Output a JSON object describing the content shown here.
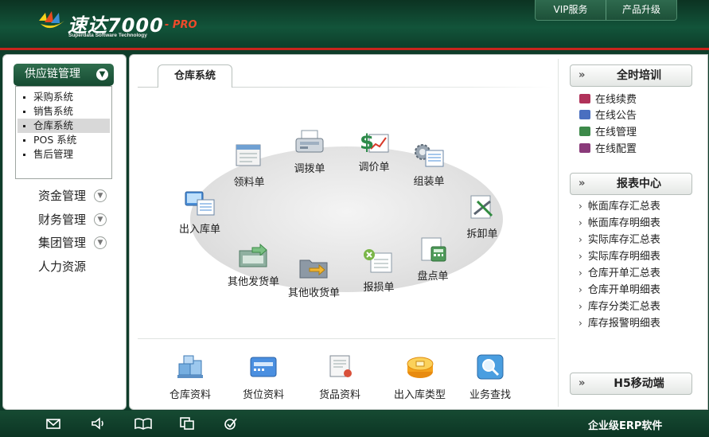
{
  "header": {
    "logo_title": "速达7000",
    "logo_suffix": "- PRO",
    "logo_subtitle": "Superdata Software Technology",
    "links": [
      "VIP服务",
      "产品升级"
    ]
  },
  "sidebar": {
    "active_category": "供应链管理",
    "sub_items": [
      {
        "label": "采购系统",
        "selected": false
      },
      {
        "label": "销售系统",
        "selected": false
      },
      {
        "label": "仓库系统",
        "selected": true
      },
      {
        "label": "POS 系统",
        "selected": false
      },
      {
        "label": "售后管理",
        "selected": false
      }
    ],
    "categories": [
      "资金管理",
      "财务管理",
      "集团管理",
      "人力资源"
    ]
  },
  "main": {
    "tab": "仓库系统",
    "workflow": [
      "出入库单",
      "领料单",
      "调拨单",
      "调价单",
      "组装单",
      "拆卸单",
      "盘点单",
      "报损单",
      "其他收货单",
      "其他发货单"
    ],
    "bottom_tools": [
      "仓库资料",
      "货位资料",
      "货品资料",
      "出入库类型",
      "业务查找"
    ]
  },
  "right": {
    "training": {
      "title": "全时培训",
      "items": [
        "在线续费",
        "在线公告",
        "在线管理",
        "在线配置"
      ]
    },
    "reports": {
      "title": "报表中心",
      "items": [
        "帐面库存汇总表",
        "帐面库存明细表",
        "实际库存汇总表",
        "实际库存明细表",
        "仓库开单汇总表",
        "仓库开单明细表",
        "库存分类汇总表",
        "库存报警明细表"
      ]
    },
    "mobile": {
      "title": "H5移动端"
    },
    "arrow_glyph": "»"
  },
  "footer": {
    "text": "企业级ERP软件",
    "icons": [
      "mail-icon",
      "speaker-icon",
      "book-icon",
      "copy-icon",
      "check-icon"
    ]
  },
  "colors": {
    "brand_green": "#12543a",
    "accent_red": "#c8251d"
  }
}
